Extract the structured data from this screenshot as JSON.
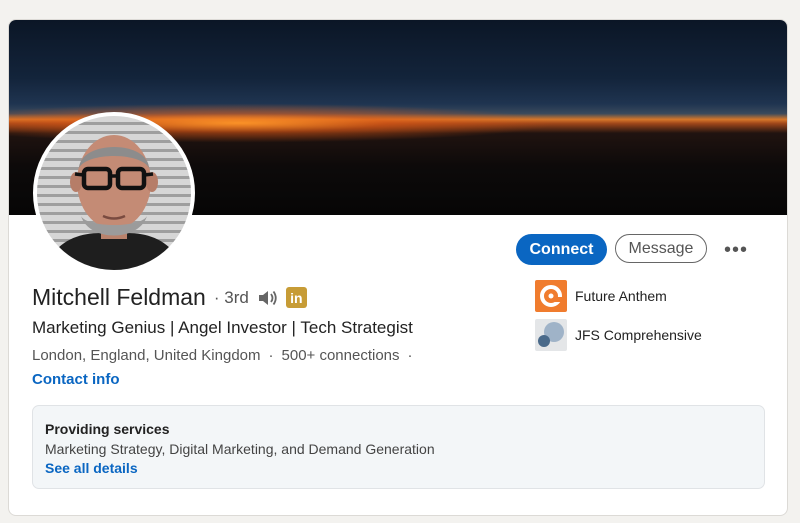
{
  "profile": {
    "name": "Mitchell Feldman",
    "degree": "3rd",
    "headline": "Marketing Genius | Angel Investor | Tech Strategist",
    "location": "London, England, United Kingdom",
    "connections": "500+ connections",
    "contact_info": "Contact info",
    "linkedin_badge": "in"
  },
  "actions": {
    "connect": "Connect",
    "message": "Message",
    "more": "•••"
  },
  "companies": [
    {
      "name": "Future Anthem",
      "icon": "future-anthem-logo"
    },
    {
      "name": "JFS Comprehensive",
      "icon": "jfs-comprehensive-logo"
    }
  ],
  "services": {
    "title": "Providing services",
    "list": "Marketing Strategy, Digital Marketing, and Demand Generation",
    "link": "See all details"
  },
  "colors": {
    "accent": "#0a66c2",
    "premium_badge": "#c79c36"
  }
}
